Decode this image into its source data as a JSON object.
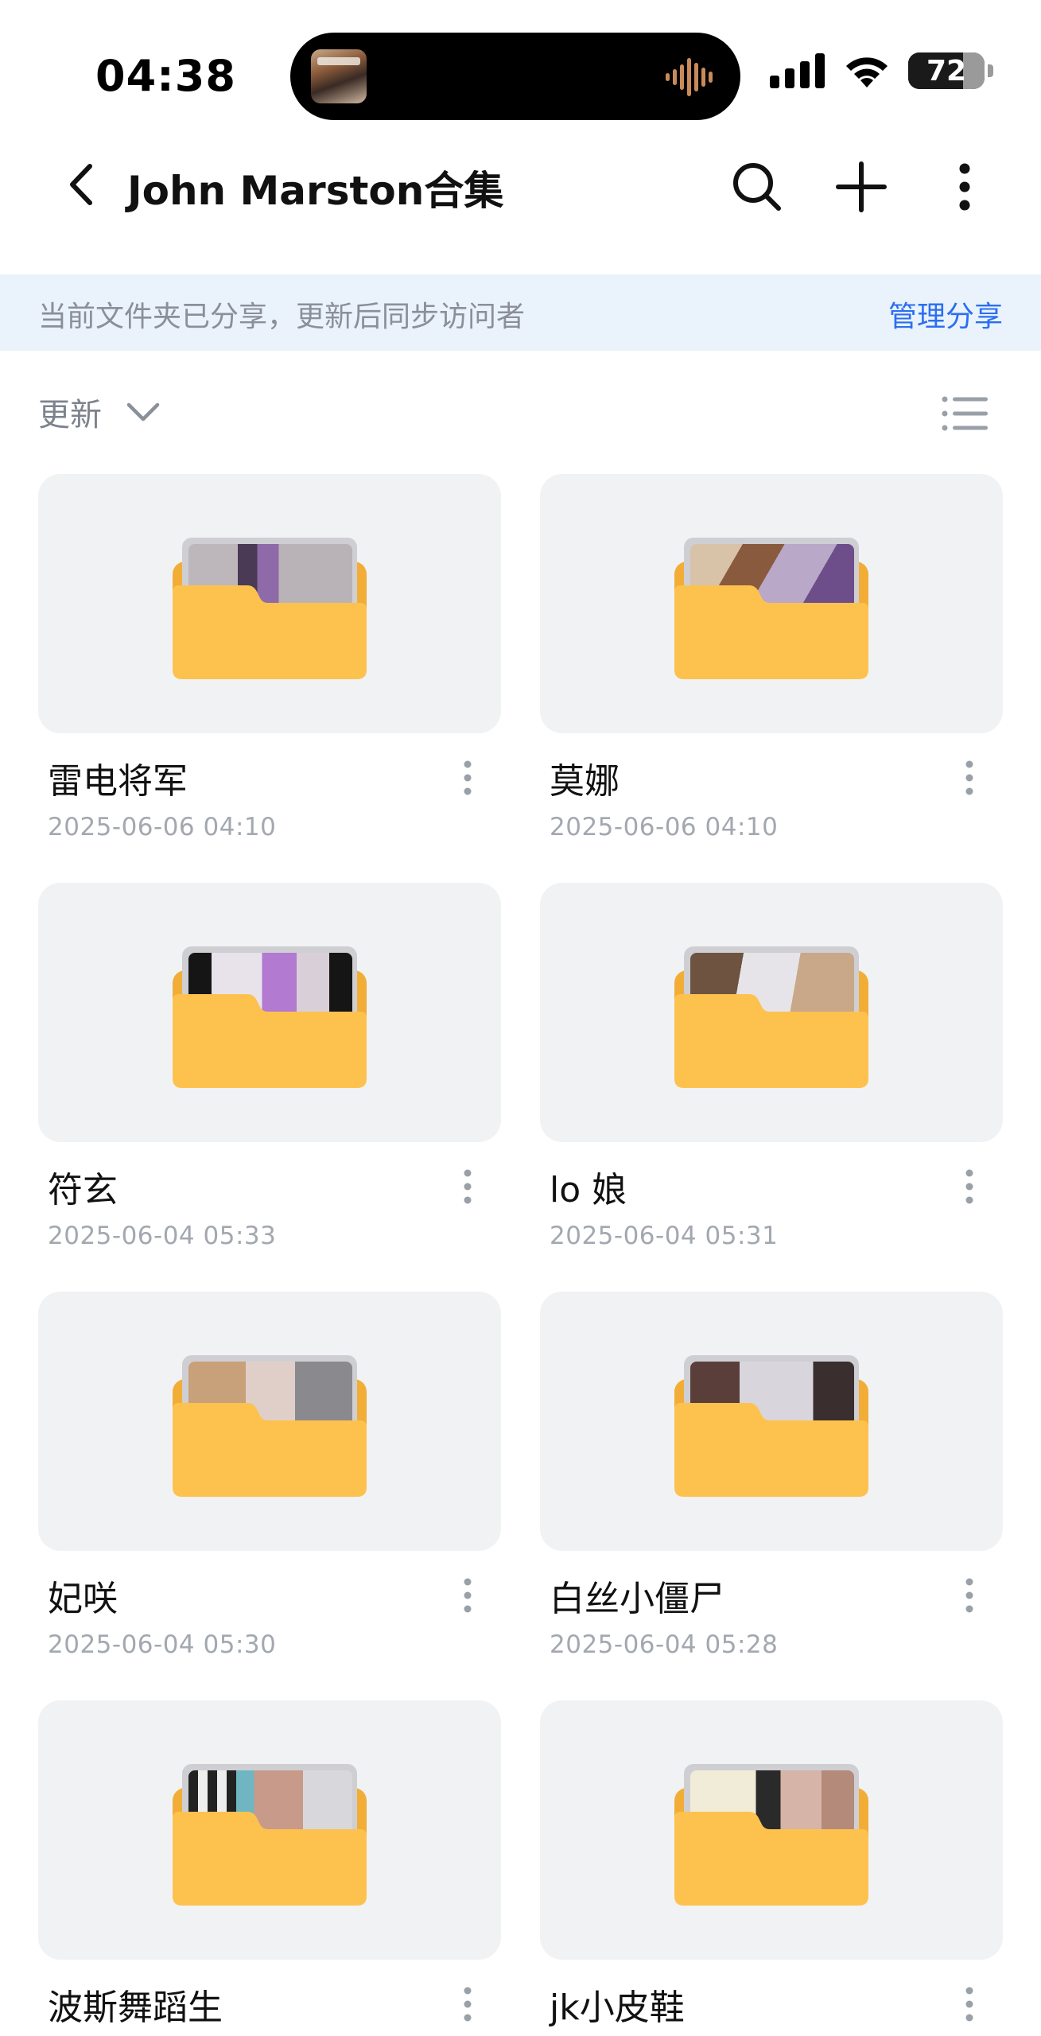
{
  "status_bar": {
    "time": "04:38",
    "battery_label": "72",
    "battery_level": 0.72,
    "icons": [
      "now-playing-album-art",
      "audio-waveform-icon",
      "cellular-signal-icon",
      "wifi-icon",
      "battery-icon"
    ]
  },
  "header": {
    "title": "John Marston合集",
    "icons": [
      "back-chevron-icon",
      "search-icon",
      "plus-icon",
      "more-vertical-icon"
    ]
  },
  "share_banner": {
    "text": "当前文件夹已分享，更新后同步访问者",
    "link": "管理分享"
  },
  "toolbar": {
    "sort_label": "更新",
    "icons": [
      "chevron-down-icon",
      "list-view-icon"
    ]
  },
  "folders": [
    {
      "name": "雷电将军",
      "date": "2025-06-06 04:10"
    },
    {
      "name": "莫娜",
      "date": "2025-06-06 04:10"
    },
    {
      "name": "符玄",
      "date": "2025-06-04 05:33"
    },
    {
      "name": "lo 娘",
      "date": "2025-06-04 05:31"
    },
    {
      "name": "妃咲",
      "date": "2025-06-04 05:30"
    },
    {
      "name": "白丝小僵尸",
      "date": "2025-06-04 05:28"
    },
    {
      "name": "波斯舞蹈生",
      "date": ""
    },
    {
      "name": "jk小皮鞋",
      "date": ""
    }
  ],
  "colors": {
    "accent": "#2b6ff0",
    "banner_bg": "#eaf2fc",
    "folder_front": "#fdc24e",
    "folder_back": "#f2ad37",
    "card_bg": "#f1f2f4",
    "secondary_text": "#a3a8b0"
  }
}
